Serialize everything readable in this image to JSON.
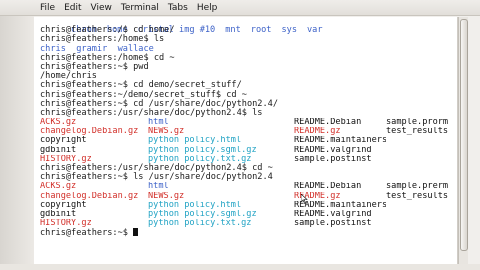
{
  "menu": [
    "File",
    "Edit",
    "View",
    "Terminal",
    "Tabs",
    "Help"
  ],
  "colors": {
    "directory": "#3d62c8",
    "archive": "#d2302a",
    "link": "#21a3c4",
    "executable": "#36a936"
  },
  "top_line": [
    "chrom",
    "home",
    "cristal img #10",
    "mnt",
    "root",
    "sys",
    "var"
  ],
  "lines_a": [
    "chris@feathers:/$ cd home/",
    "chris@feathers:/home$ ls",
    "chris  gramir  wallace",
    "chris@feathers:/home$ cd ~",
    "chris@feathers:~$ pwd",
    "/home/chris",
    "chris@feathers:~$ cd demo/secret_stuff/",
    "chris@feathers:~/demo/secret_stuff$ cd ~",
    "chris@feathers:~$ cd /usr/share/doc/python2.4/",
    "chris@feathers:/usr/share/doc/python2.4$ ls"
  ],
  "listing_1": [
    [
      "ACKS.gz",
      "html",
      "README.Debian",
      "sample.prorm"
    ],
    [
      "changelog.Debian.gz",
      "NEWS.gz",
      "README.gz",
      "test_results"
    ],
    [
      "copyright",
      "python policy.html",
      "README.maintainers",
      ""
    ],
    [
      "gdbinit",
      "python policy.sgml.gz",
      "README.valgrind",
      ""
    ],
    [
      "HISTORY.gz",
      "python policy.txt.gz",
      "sample.postinst",
      ""
    ]
  ],
  "lines_b": [
    "chris@feathers:/usr/share/doc/python2.4$ cd ~",
    "chris@feathers:~$ ls /usr/share/doc/python2.4"
  ],
  "listing_2": [
    [
      "ACKS.gz",
      "html",
      "README.Debian",
      "sample.prerm"
    ],
    [
      "changelog.Debian.gz",
      "NEWS.gz",
      "README.gz",
      "test_results"
    ],
    [
      "copyright",
      "python policy.html",
      "README.maintainers",
      ""
    ],
    [
      "gdbinit",
      "python policy.sgml.gz",
      "README.valgrind",
      ""
    ],
    [
      "HISTORY.gz",
      "python policy.txt.gz",
      "sample.postinst",
      ""
    ]
  ],
  "prompt_final": "chris@feathers:~$ "
}
